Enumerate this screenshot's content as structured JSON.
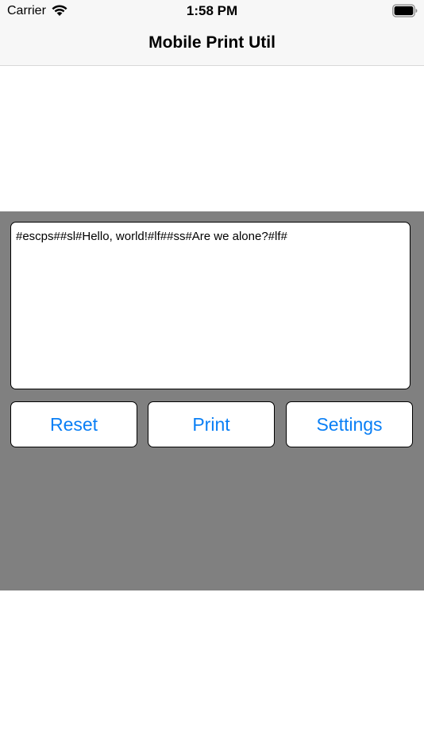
{
  "status_bar": {
    "carrier": "Carrier",
    "time": "1:58 PM",
    "wifi_icon": "wifi-icon",
    "battery_icon": "battery-icon"
  },
  "nav": {
    "title": "Mobile Print Util"
  },
  "editor": {
    "value": "#escps##sl#Hello, world!#lf##ss#Are we alone?#lf#"
  },
  "buttons": {
    "reset_label": "Reset",
    "print_label": "Print",
    "settings_label": "Settings"
  },
  "colors": {
    "accent": "#0a7ff5",
    "panel": "#808080",
    "bar": "#f7f7f7"
  }
}
